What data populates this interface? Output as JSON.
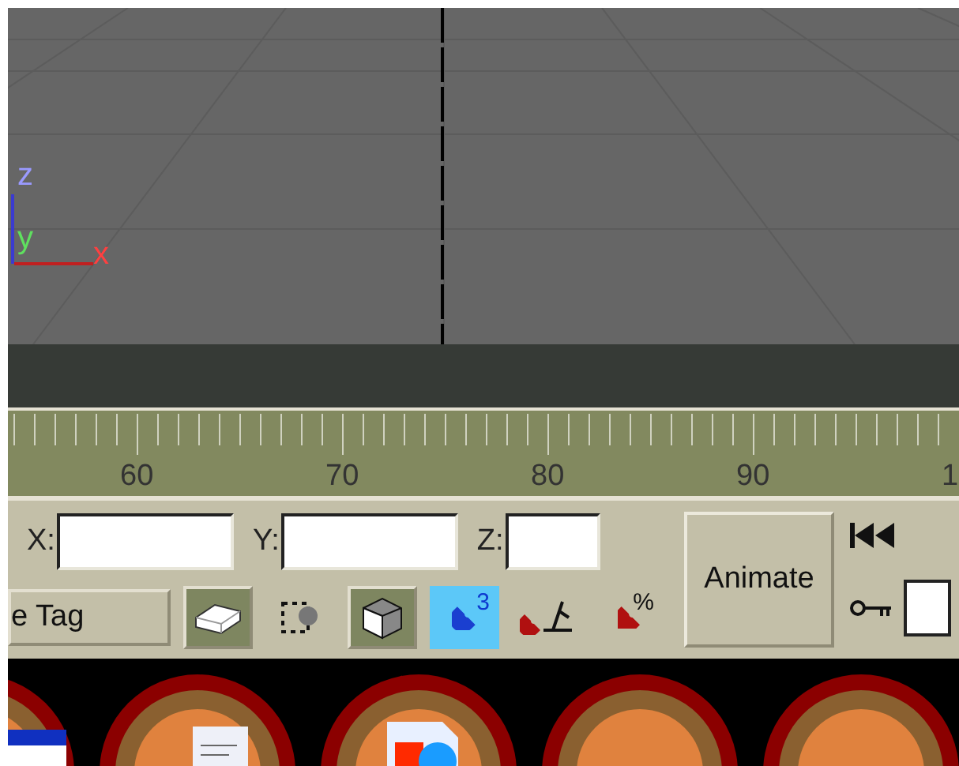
{
  "viewport": {
    "axes": [
      {
        "label": "z",
        "kind": "z"
      },
      {
        "label": "y",
        "kind": "y"
      },
      {
        "label": "x",
        "kind": "x"
      }
    ]
  },
  "timeline": {
    "labels": [
      "60",
      "70",
      "80",
      "90",
      "1"
    ]
  },
  "coordinates": [
    {
      "label": "X:",
      "kind": "wide"
    },
    {
      "label": "Y:",
      "kind": "wide"
    },
    {
      "label": "Z:",
      "kind": "narrow"
    }
  ],
  "tag_field": {
    "value": "e Tag"
  },
  "tools": [
    {
      "kind": "box",
      "pressed": true,
      "highlighted": false
    },
    {
      "kind": "select",
      "pressed": false,
      "highlighted": false
    },
    {
      "kind": "cube",
      "pressed": true,
      "highlighted": false
    },
    {
      "kind": "snap",
      "badge": "3",
      "pressed": false,
      "highlighted": true
    },
    {
      "kind": "angle",
      "pressed": false,
      "highlighted": false
    },
    {
      "kind": "percent",
      "badge": "%",
      "pressed": false,
      "highlighted": false
    }
  ],
  "animate_button": {
    "label": "Animate"
  }
}
